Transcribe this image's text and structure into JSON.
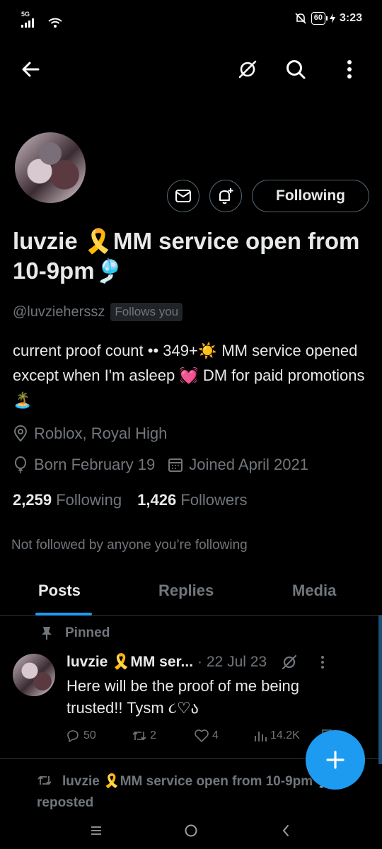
{
  "status_bar": {
    "network": "5G",
    "battery": "60",
    "time": "3:23"
  },
  "profile": {
    "display_name": "luvzie 🎗️MM service open from 10-9pm🎐",
    "handle": "@luvzieherssz",
    "follows_you": "Follows you",
    "following_button": "Following",
    "bio": "current proof count •• 349+☀️ MM service opened except when I'm asleep 💓  DM for paid promotions 🏝️",
    "location": "Roblox, Royal High",
    "birthday": "Born February 19",
    "joined": "Joined April 2021",
    "following_count": "2,259",
    "following_label": "Following",
    "followers_count": "1,426",
    "followers_label": "Followers",
    "not_followed": "Not followed by anyone you’re following"
  },
  "tabs": [
    {
      "label": "Posts"
    },
    {
      "label": "Replies"
    },
    {
      "label": "Media"
    }
  ],
  "pinned_tweet": {
    "pinned_label": "Pinned",
    "name": "luvzie 🎗️MM ser...",
    "date": "· 22 Jul 23",
    "text": "Here will be the proof of me being trusted!! Tysm ૮♡ა",
    "replies": "50",
    "reposts": "2",
    "likes": "4",
    "views": "14.2K"
  },
  "next_tweet": {
    "repost_text": "luvzie 🎗️MM service open from 10-9pm 🎐 reposted"
  },
  "colors": {
    "accent": "#1d9bf0",
    "text": "#e7e9ea",
    "muted": "#71767b",
    "border": "#536471"
  }
}
